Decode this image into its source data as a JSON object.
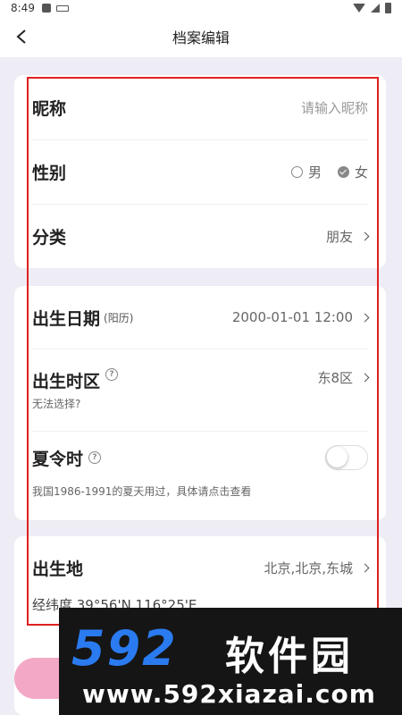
{
  "status_bar": {
    "time": "8:49"
  },
  "nav": {
    "title": "档案编辑"
  },
  "profile": {
    "nickname_label": "昵称",
    "nickname_placeholder": "请输入昵称",
    "gender_label": "性别",
    "gender_options": [
      "男",
      "女"
    ],
    "gender_selected": "女",
    "category_label": "分类",
    "category_value": "朋友"
  },
  "birth": {
    "date_label": "出生日期",
    "calendar_tag": "(阳历)",
    "date_value": "2000-01-01 12:00",
    "timezone_label": "出生时区",
    "timezone_value": "东8区",
    "timezone_hint": "无法选择?",
    "dst_label": "夏令时",
    "dst_hint": "我国1986-1991的夏天用过，具体请点击查看",
    "dst_enabled": false
  },
  "place": {
    "label": "出生地",
    "value": "北京,北京,东城",
    "coords": "经纬度 39°56'N 116°25'E"
  },
  "watermark": {
    "logo": "592",
    "text": "软件园",
    "url": "www.592xiazai.com"
  }
}
